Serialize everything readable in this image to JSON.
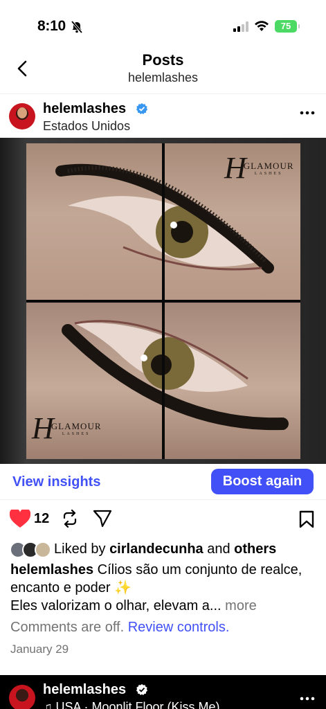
{
  "status_bar": {
    "time": "8:10",
    "battery": "75"
  },
  "header": {
    "title": "Posts",
    "subtitle": "helemlashes"
  },
  "post": {
    "username": "helemlashes",
    "location": "Estados Unidos",
    "image_logo": {
      "letter": "H",
      "brand": "GLAMOUR",
      "sub": "LASHES"
    },
    "view_insights": "View insights",
    "boost_label": "Boost again",
    "like_count": "12",
    "liked_by_prefix": "Liked by",
    "liked_by_user": "cirlandecunha",
    "liked_by_and": "and",
    "liked_by_others": "others",
    "caption_user": "helemlashes",
    "caption_line1": "Cílios são um conjunto de realce, encanto e poder ✨",
    "caption_line2": "Eles valorizam o olhar, elevam a...",
    "caption_more": "more",
    "comments_off": "Comments are off.",
    "review_controls": "Review controls.",
    "date": "January 29"
  },
  "next_post": {
    "username": "helemlashes",
    "audio": "♫ USA · Moonlit Floor (Kiss Me)"
  },
  "colors": {
    "accent": "#4150f7",
    "heart": "#ff3040",
    "battery": "#4cd964"
  }
}
